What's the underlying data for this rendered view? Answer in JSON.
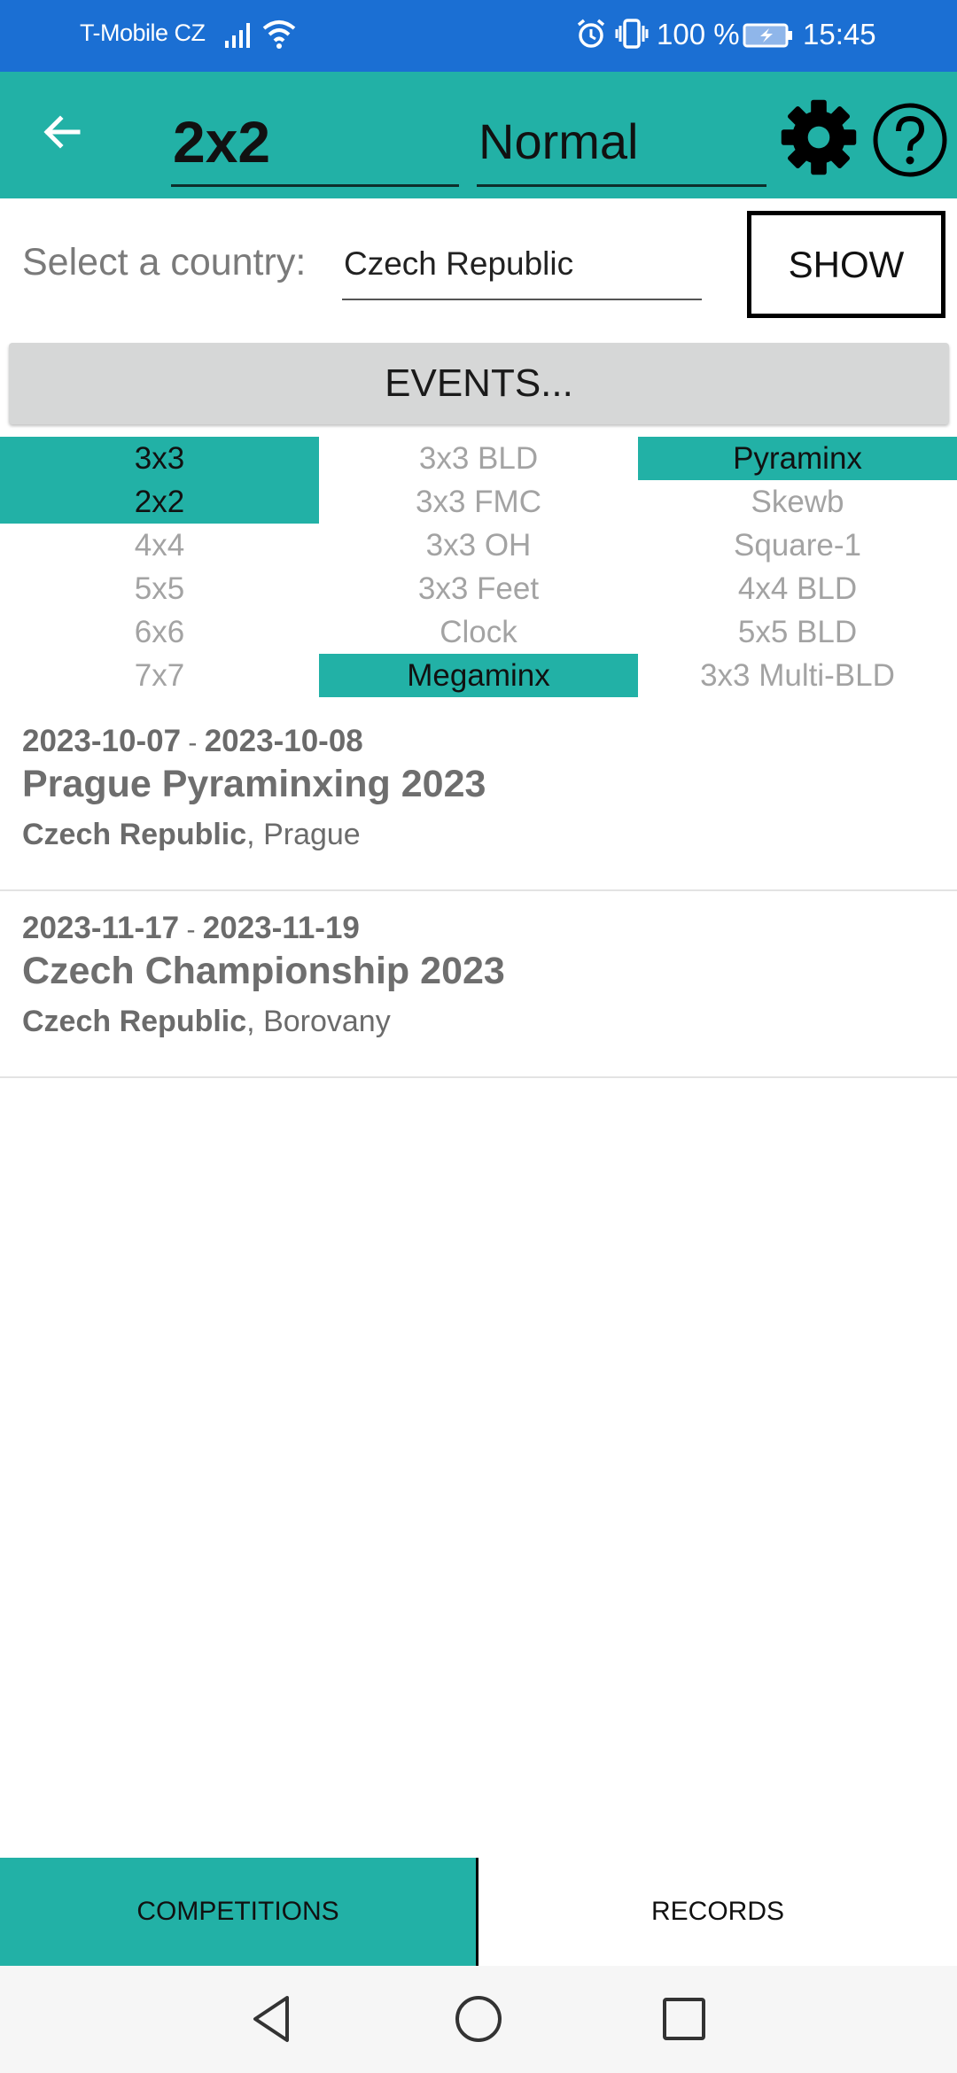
{
  "status_bar": {
    "carrier": "T-Mobile CZ",
    "battery": "100 %",
    "time": "15:45"
  },
  "toolbar": {
    "puzzle": "2x2",
    "mode": "Normal"
  },
  "country": {
    "label": "Select a country:",
    "value": "Czech Republic",
    "show_label": "SHOW"
  },
  "events_button": "EVENTS...",
  "events": [
    {
      "label": "3x3",
      "selected": true
    },
    {
      "label": "3x3 BLD",
      "selected": false
    },
    {
      "label": "Pyraminx",
      "selected": true
    },
    {
      "label": "2x2",
      "selected": true
    },
    {
      "label": "3x3 FMC",
      "selected": false
    },
    {
      "label": "Skewb",
      "selected": false
    },
    {
      "label": "4x4",
      "selected": false
    },
    {
      "label": "3x3 OH",
      "selected": false
    },
    {
      "label": "Square-1",
      "selected": false
    },
    {
      "label": "5x5",
      "selected": false
    },
    {
      "label": "3x3 Feet",
      "selected": false
    },
    {
      "label": "4x4 BLD",
      "selected": false
    },
    {
      "label": "6x6",
      "selected": false
    },
    {
      "label": "Clock",
      "selected": false
    },
    {
      "label": "5x5 BLD",
      "selected": false
    },
    {
      "label": "7x7",
      "selected": false
    },
    {
      "label": "Megaminx",
      "selected": true
    },
    {
      "label": "3x3 Multi-BLD",
      "selected": false
    }
  ],
  "competitions": [
    {
      "start": "2023-10-07",
      "sep": " - ",
      "end": "2023-10-08",
      "name": "Prague Pyraminxing 2023",
      "country": "Czech Republic",
      "city": ", Prague"
    },
    {
      "start": "2023-11-17",
      "sep": " - ",
      "end": "2023-11-19",
      "name": "Czech Championship 2023",
      "country": "Czech Republic",
      "city": ", Borovany"
    }
  ],
  "tabs": {
    "competitions": "COMPETITIONS",
    "records": "RECORDS"
  },
  "colors": {
    "accent": "#22b1a6",
    "status_bar": "#1b6fd3"
  },
  "icons": {
    "back": "arrow-left-icon",
    "settings": "gear-icon",
    "help": "help-icon"
  }
}
